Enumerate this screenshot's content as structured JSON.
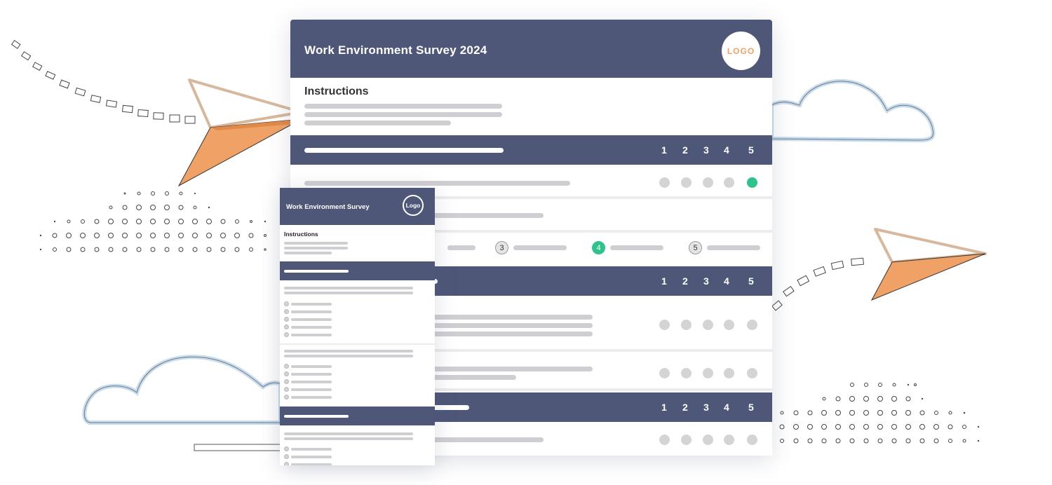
{
  "survey": {
    "title": "Work Environment Survey 2024",
    "logo": "LOGO",
    "instructions_heading": "Instructions",
    "scale": [
      "1",
      "2",
      "3",
      "4",
      "5"
    ],
    "options": [
      "3",
      "4",
      "5"
    ],
    "selected_row1": 5,
    "selected_option": "4"
  },
  "mobile": {
    "title": "Work Environment Survey",
    "logo": "Logo",
    "instructions_heading": "Instructions"
  },
  "colors": {
    "header": "#4f5779",
    "selected": "#2ec28c",
    "accent_orange": "#f0a266",
    "cloud_blue": "#c9dcec"
  },
  "icons": [
    "paper-plane-icon",
    "cloud-icon",
    "logo-icon"
  ]
}
